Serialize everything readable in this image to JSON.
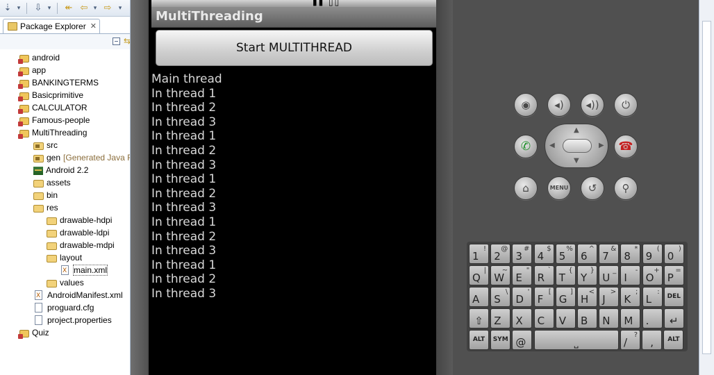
{
  "eclipse": {
    "tab_label": "Package Explorer",
    "tab_close": "✕",
    "tree": [
      {
        "label": "android",
        "icon": "project-icon",
        "indent": 0
      },
      {
        "label": "app",
        "icon": "project-icon",
        "indent": 0
      },
      {
        "label": "BANKINGTERMS",
        "icon": "project-icon",
        "indent": 0
      },
      {
        "label": "Basicprimitive",
        "icon": "project-icon",
        "indent": 0
      },
      {
        "label": "CALCULATOR",
        "icon": "project-icon",
        "indent": 0
      },
      {
        "label": "Famous-people",
        "icon": "project-icon",
        "indent": 0
      },
      {
        "label": "MultiThreading",
        "icon": "project-icon",
        "indent": 0
      },
      {
        "label": "src",
        "icon": "package-folder-icon",
        "indent": 1
      },
      {
        "label": "gen",
        "extra": "[Generated Java Fi",
        "icon": "package-folder-icon",
        "indent": 1
      },
      {
        "label": "Android 2.2",
        "icon": "library-icon",
        "indent": 1
      },
      {
        "label": "assets",
        "icon": "folder-icon",
        "indent": 1
      },
      {
        "label": "bin",
        "icon": "folder-icon",
        "indent": 1
      },
      {
        "label": "res",
        "icon": "folder-icon",
        "indent": 1
      },
      {
        "label": "drawable-hdpi",
        "icon": "folder-icon",
        "indent": 2
      },
      {
        "label": "drawable-ldpi",
        "icon": "folder-icon",
        "indent": 2
      },
      {
        "label": "drawable-mdpi",
        "icon": "folder-icon",
        "indent": 2
      },
      {
        "label": "layout",
        "icon": "folder-icon",
        "indent": 2
      },
      {
        "label": "main.xml",
        "icon": "xml-file-icon",
        "indent": 3,
        "selected": true
      },
      {
        "label": "values",
        "icon": "folder-icon",
        "indent": 2
      },
      {
        "label": "AndroidManifest.xml",
        "icon": "xml-file-icon",
        "indent": 1
      },
      {
        "label": "proguard.cfg",
        "icon": "file-icon",
        "indent": 1
      },
      {
        "label": "project.properties",
        "icon": "file-icon",
        "indent": 1
      },
      {
        "label": "Quiz",
        "icon": "project-icon",
        "indent": 0
      }
    ]
  },
  "app": {
    "title": "MultiThreading",
    "start_button_label": "Start MULTITHREAD",
    "output_lines": [
      "Main thread",
      "In thread 1",
      "In thread 2",
      "In thread 3",
      "In thread 1",
      "In thread 2",
      "In thread 3",
      "In thread 1",
      "In thread 2",
      "In thread 3",
      "In thread 1",
      "In thread 2",
      "In thread 3",
      "In thread 1",
      "In thread 2",
      "In thread 3"
    ]
  },
  "controls": {
    "menu_label": "MENU"
  },
  "keyboard": {
    "rows": [
      [
        {
          "m": "1",
          "a": "!"
        },
        {
          "m": "2",
          "a": "@"
        },
        {
          "m": "3",
          "a": "#"
        },
        {
          "m": "4",
          "a": "$"
        },
        {
          "m": "5",
          "a": "%"
        },
        {
          "m": "6",
          "a": "^"
        },
        {
          "m": "7",
          "a": "&"
        },
        {
          "m": "8",
          "a": "*"
        },
        {
          "m": "9",
          "a": "("
        },
        {
          "m": "0",
          "a": ")"
        }
      ],
      [
        {
          "m": "Q",
          "a": "|"
        },
        {
          "m": "W",
          "a": "~"
        },
        {
          "m": "E",
          "a": "\""
        },
        {
          "m": "R",
          "a": "`"
        },
        {
          "m": "T",
          "a": "{"
        },
        {
          "m": "Y",
          "a": "}"
        },
        {
          "m": "U",
          "a": "_"
        },
        {
          "m": "I",
          "a": "-"
        },
        {
          "m": "O",
          "a": "+"
        },
        {
          "m": "P",
          "a": "="
        }
      ],
      [
        {
          "m": "A",
          "a": ""
        },
        {
          "m": "S",
          "a": "\\"
        },
        {
          "m": "D",
          "a": "'"
        },
        {
          "m": "F",
          "a": "["
        },
        {
          "m": "G",
          "a": "]"
        },
        {
          "m": "H",
          "a": "<"
        },
        {
          "m": "J",
          "a": ">"
        },
        {
          "m": "K",
          "a": ";"
        },
        {
          "m": "L",
          "a": ":"
        },
        {
          "m": "DEL",
          "a": "",
          "small": true
        }
      ],
      [
        {
          "m": "⇧",
          "a": ""
        },
        {
          "m": "Z",
          "a": ""
        },
        {
          "m": "X",
          "a": ""
        },
        {
          "m": "C",
          "a": ""
        },
        {
          "m": "V",
          "a": ""
        },
        {
          "m": "B",
          "a": ""
        },
        {
          "m": "N",
          "a": ""
        },
        {
          "m": "M",
          "a": ""
        },
        {
          "m": ".",
          "a": ""
        },
        {
          "m": "↵",
          "a": ""
        }
      ]
    ],
    "bottom_row": {
      "alt_left": "ALT",
      "sym": "SYM",
      "at": "@",
      "space": "⎵",
      "slash": "/",
      "slash_alt": "?",
      "comma": ",",
      "alt_right": "ALT"
    }
  }
}
